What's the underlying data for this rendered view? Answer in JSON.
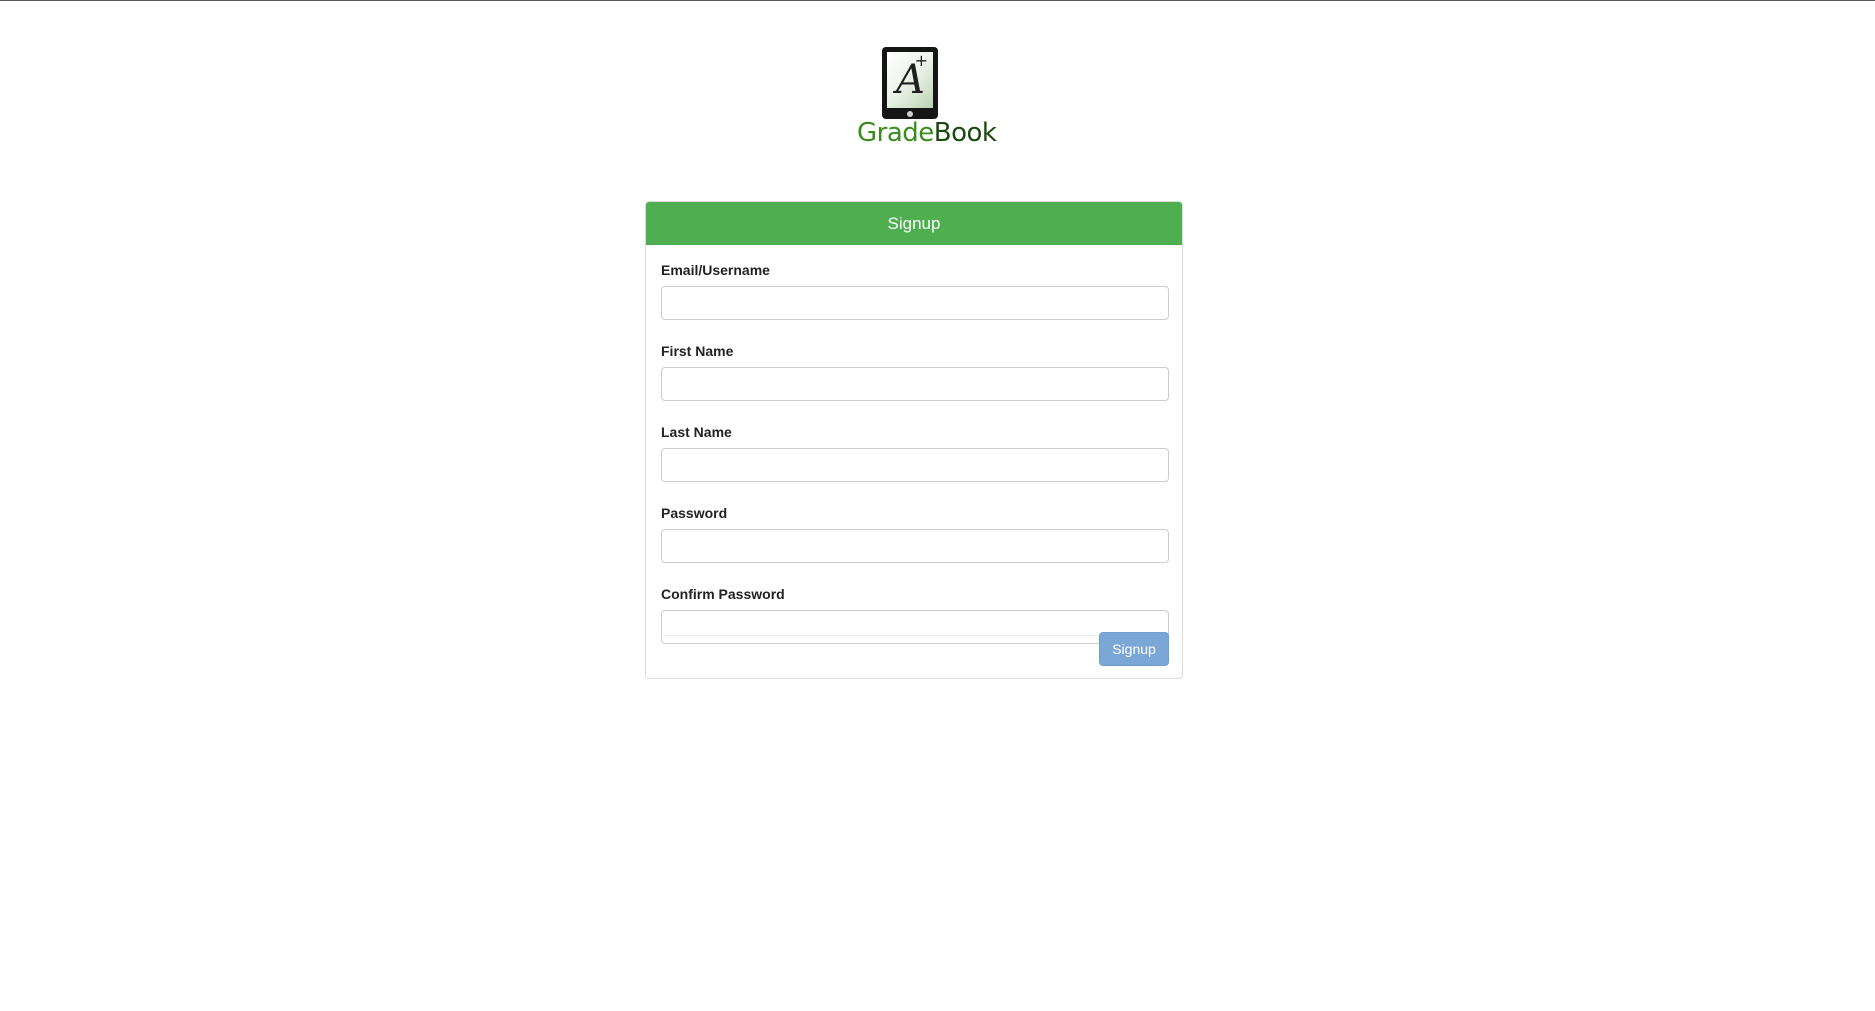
{
  "app": {
    "brand_part1": "Grade",
    "brand_part2": "Book",
    "logo_letter": "A",
    "logo_plus": "+"
  },
  "panel": {
    "title": "Signup"
  },
  "form": {
    "fields": [
      {
        "label": "Email/Username",
        "value": "",
        "placeholder": ""
      },
      {
        "label": "First Name",
        "value": "",
        "placeholder": ""
      },
      {
        "label": "Last Name",
        "value": "",
        "placeholder": ""
      },
      {
        "label": "Password",
        "value": "",
        "placeholder": ""
      },
      {
        "label": "Confirm Password",
        "value": "",
        "placeholder": ""
      }
    ],
    "submit_label": "Signup"
  },
  "colors": {
    "header_green": "#4fae50",
    "brand_green": "#3a8d1d",
    "brand_dark_green": "#1c4a0f",
    "button_blue": "#7ba7d7"
  },
  "icons": {
    "logo": "tablet-grade-a-plus-icon"
  }
}
